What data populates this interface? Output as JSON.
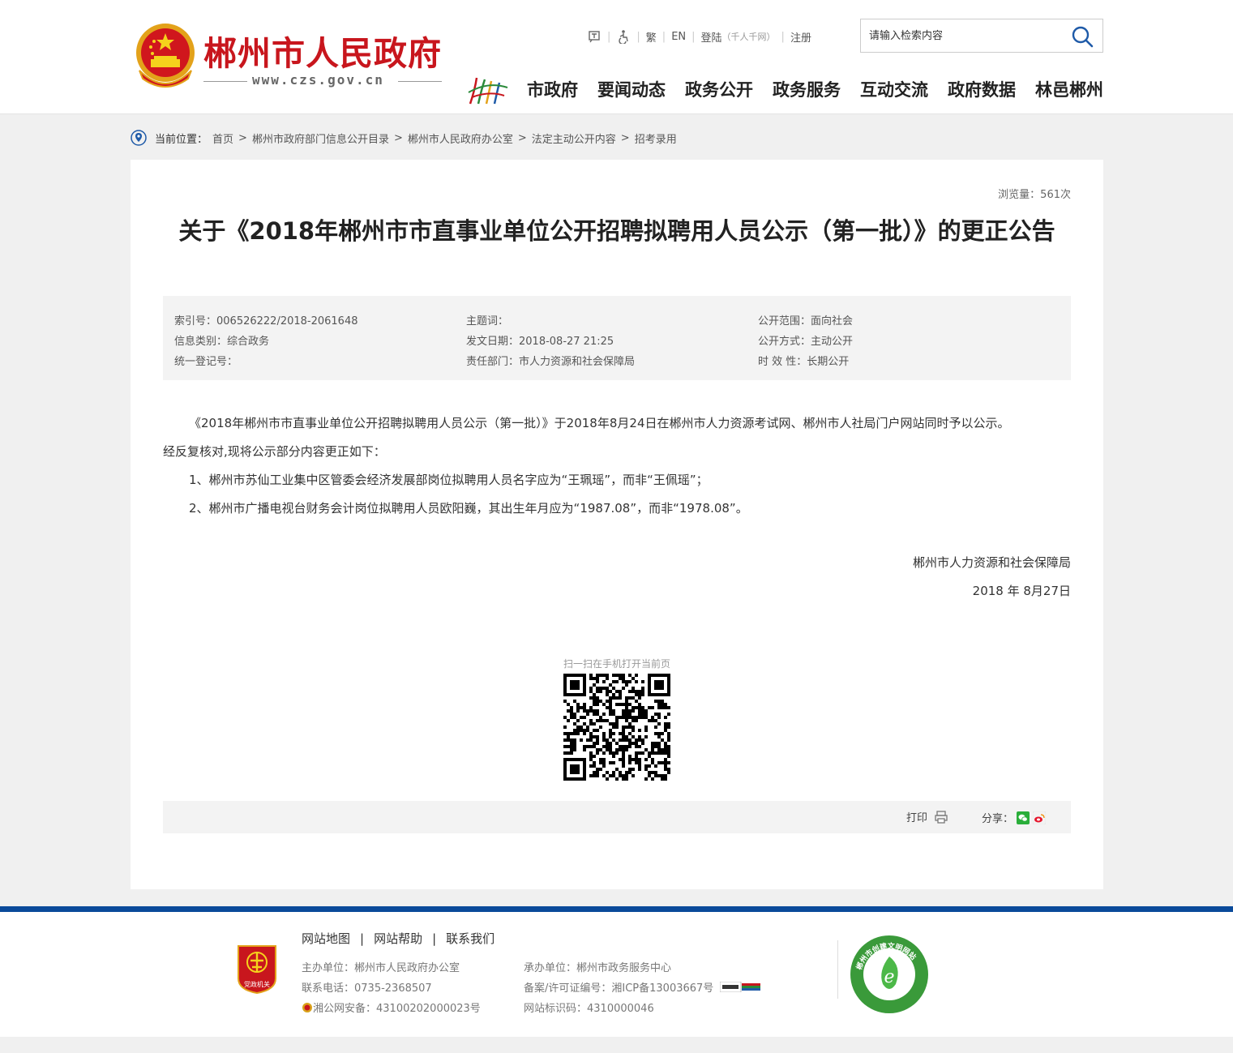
{
  "header": {
    "site_title": "郴州市人民政府",
    "site_url": "www.czs.gov.cn",
    "tools": {
      "traditional": "繁",
      "english": "EN",
      "login": "登陆",
      "login_sub": "（千人千网）",
      "register": "注册"
    },
    "search": {
      "placeholder": "请输入检索内容"
    },
    "nav": [
      "市政府",
      "要闻动态",
      "政务公开",
      "政务服务",
      "互动交流",
      "政府数据",
      "林邑郴州"
    ]
  },
  "breadcrumb": {
    "label": "当前位置：",
    "items": [
      "首页",
      "郴州市政府部门信息公开目录",
      "郴州市人民政府办公室",
      "法定主动公开内容",
      "招考录用"
    ]
  },
  "article": {
    "views": "浏览量：561次",
    "title": "关于《2018年郴州市市直事业单位公开招聘拟聘用人员公示（第一批）》的更正公告",
    "meta": {
      "index_no": "索引号：006526222/2018-2061648",
      "category": "信息类别：综合政务",
      "reg_no": "统一登记号：",
      "keywords": "主题词：",
      "date": "发文日期：2018-08-27 21:25",
      "dept": "责任部门：市人力资源和社会保障局",
      "scope": "公开范围：面向社会",
      "mode": "公开方式：主动公开",
      "validity": "时 效 性：长期公开"
    },
    "paragraphs": [
      "《2018年郴州市市直事业单位公开招聘拟聘用人员公示（第一批）》于2018年8月24日在郴州市人力资源考试网、郴州市人社局门户网站同时予以公示。",
      "经反复核对,现将公示部分内容更正如下：",
      "1、郴州市苏仙工业集中区管委会经济发展部岗位拟聘用人员名字应为“王珮瑶”，而非“王佩瑶”；",
      "2、郴州市广播电视台财务会计岗位拟聘用人员欧阳巍，其出生年月应为“1987.08”，而非“1978.08”。"
    ],
    "signature_org": "郴州市人力资源和社会保障局",
    "signature_date": "2018 年 8月27日",
    "qr_label": "扫一扫在手机打开当前页",
    "print": "打印",
    "share": "分享："
  },
  "footer": {
    "links": [
      "网站地图",
      "网站帮助",
      "联系我们"
    ],
    "host": "主办单位：郴州市人民政府办公室",
    "phone": "联系电话：0735-2368507",
    "police": "湘公网安备：43100202000023号",
    "undertaker": "承办单位：郴州市政务服务中心",
    "icp": "备案/许可证编号：湘ICP备13003667号",
    "site_code": "网站标识码：4310000046",
    "party_badge_text": "党政机关",
    "civil_badge_text": "郴州市创建文明网站"
  },
  "colors": {
    "brand_red": "#c8161d",
    "footer_blue": "#0a4a9a",
    "meta_bg": "#f3f3f3"
  }
}
